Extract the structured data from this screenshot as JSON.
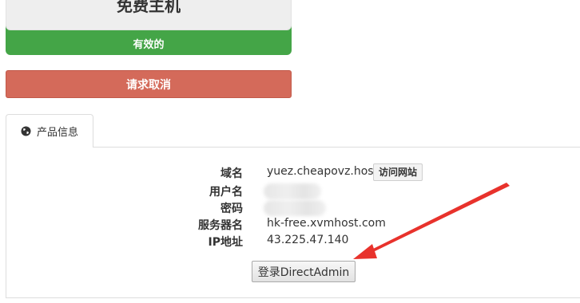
{
  "product": {
    "name": "免费主机",
    "status": "有效的"
  },
  "actions": {
    "cancel_label": "请求取消"
  },
  "tabs": [
    {
      "label": "产品信息",
      "icon": "globe-icon"
    }
  ],
  "info": {
    "domain_label": "域名",
    "domain_value": "yuez.cheapovz.host",
    "visit_label": "访问网站",
    "username_label": "用户名",
    "password_label": "密码",
    "server_label": "服务器名",
    "server_value": "hk-free.xvmhost.com",
    "ip_label": "IP地址",
    "ip_value": "43.225.47.140"
  },
  "login_button_label": "登录DirectAdmin",
  "colors": {
    "status_green": "#44a547",
    "cancel_red": "#d46a5a",
    "annotation_arrow": "#e8322c"
  }
}
